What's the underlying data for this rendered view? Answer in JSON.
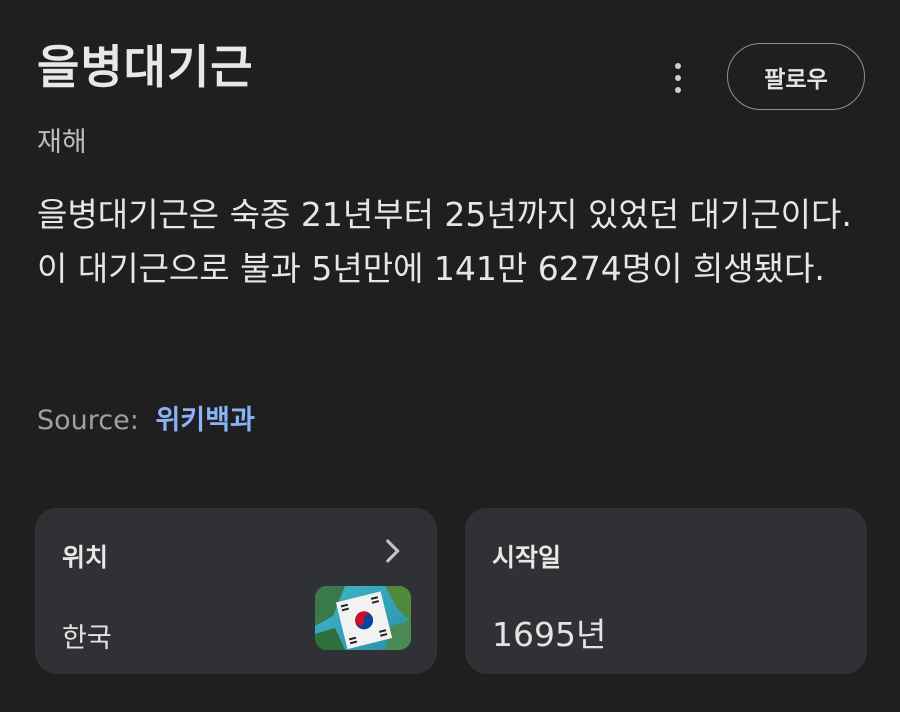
{
  "header": {
    "title": "을병대기근",
    "subtitle": "재해",
    "follow_label": "팔로우",
    "more_icon": "more-vert-icon"
  },
  "description": "을병대기근은 숙종 21년부터 25년까지 있었던 대기근이다. 이 대기근으로 불과 5년만에 141만 6274명이 희생됐다.",
  "source": {
    "label": "Source",
    "separator": ":",
    "link_text": "위키백과"
  },
  "cards": {
    "location": {
      "label": "위치",
      "value": "한국",
      "icon": "chevron-right-icon",
      "thumbnail": "korea-flag-thumbnail"
    },
    "start_date": {
      "label": "시작일",
      "value": "1695년"
    }
  },
  "colors": {
    "background": "#1f1f1f",
    "card": "#303134",
    "link": "#8ab4f8",
    "text": "#e3e3e3"
  }
}
